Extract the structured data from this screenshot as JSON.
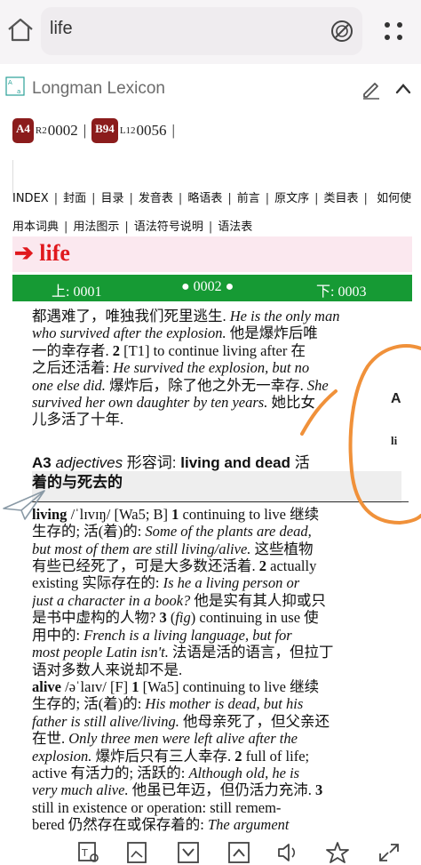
{
  "search": {
    "query": "life"
  },
  "dictionary": {
    "name": "Longman Lexicon"
  },
  "references": [
    {
      "tag": "A4",
      "sup": "R2",
      "num": "0002"
    },
    {
      "tag": "B94",
      "sup": "L12",
      "num": "0056"
    }
  ],
  "nav_links": [
    "INDEX",
    "封面",
    "目录",
    "发音表",
    "略语表",
    "前言",
    "原文序",
    "类目表",
    "如何使用本词典",
    "用法图示",
    "语法符号说明",
    "语法表"
  ],
  "headword": "➔ life",
  "pager": {
    "prev": "上: 0001",
    "current": "● 0002 ●",
    "next": "下: 0003"
  },
  "side_peek": {
    "a": "A",
    "b": "li"
  },
  "colors": {
    "ref_tag": "#8b1c1c",
    "pager_bg": "#169a34",
    "headword": "#e0191e",
    "headword_bg": "#fbe8ef",
    "pen": "#f0913a"
  },
  "icons": [
    "home-icon",
    "clear-icon",
    "more-icon",
    "edit-icon",
    "collapse-icon",
    "plane-icon",
    "ocr-icon",
    "image-icon",
    "chevron-down-icon",
    "chevron-up-icon",
    "speaker-icon",
    "star-icon",
    "expand-icon"
  ]
}
